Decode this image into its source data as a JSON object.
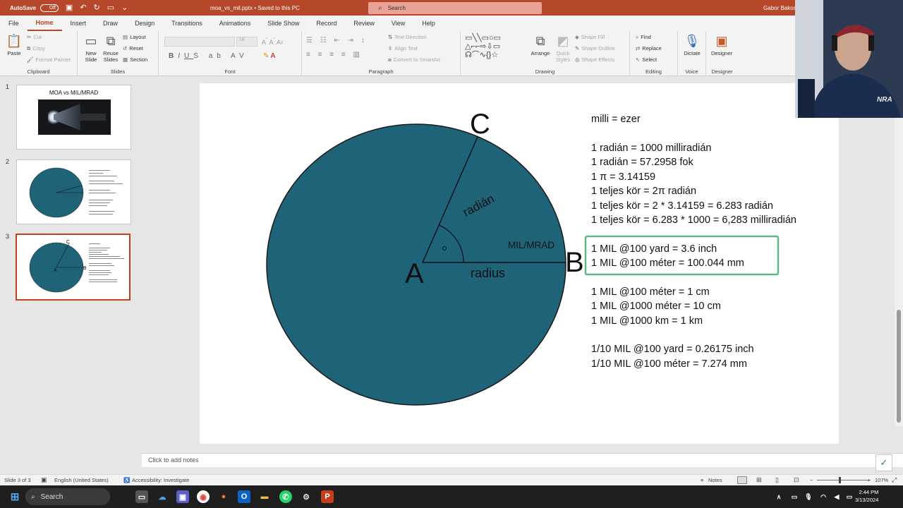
{
  "titlebar": {
    "autosave_label": "AutoSave",
    "autosave_state": "Off",
    "document_title": "moa_vs_mil.pptx • Saved to this PC",
    "search_placeholder": "Search",
    "user_name": "Gabor Bakos"
  },
  "menu_tabs": [
    "File",
    "Home",
    "Insert",
    "Draw",
    "Design",
    "Transitions",
    "Animations",
    "Slide Show",
    "Record",
    "Review",
    "View",
    "Help"
  ],
  "active_tab": "Home",
  "ribbon": {
    "clipboard": {
      "paste": "Paste",
      "cut": "Cut",
      "copy": "Copy",
      "format_painter": "Format Painter",
      "label": "Clipboard"
    },
    "slides": {
      "new_slide": "New Slide",
      "reuse_slides": "Reuse Slides",
      "layout": "Layout",
      "reset": "Reset",
      "section": "Section",
      "label": "Slides"
    },
    "font": {
      "label": "Font",
      "size": "18"
    },
    "paragraph": {
      "text_direction": "Text Direction",
      "align_text": "Align Text",
      "convert_smartart": "Convert to SmartArt",
      "label": "Paragraph"
    },
    "drawing": {
      "arrange": "Arrange",
      "quick_styles": "Quick Styles",
      "shape_fill": "Shape Fill",
      "shape_outline": "Shape Outline",
      "shape_effects": "Shape Effects",
      "label": "Drawing"
    },
    "editing": {
      "find": "Find",
      "replace": "Replace",
      "select": "Select",
      "label": "Editing"
    },
    "voice": {
      "dictate": "Dictate",
      "label": "Voice"
    },
    "designer": {
      "designer": "Designer",
      "label": "Designer"
    }
  },
  "thumbnails": [
    {
      "number": "1",
      "title": "MOA vs MIL/MRAD"
    },
    {
      "number": "2",
      "title": ""
    },
    {
      "number": "3",
      "title": "",
      "point_labels": [
        "C",
        "A",
        "B"
      ]
    }
  ],
  "slide": {
    "labels": {
      "c": "C",
      "a": "A",
      "b": "B",
      "radian": "radián",
      "mil_mrad": "MIL/MRAD",
      "radius": "radius"
    },
    "circle_color": "#1f6379",
    "highlight_color": "#5cb88a",
    "lines": [
      "milli = ezer",
      "1 radián = 1000 milliradián",
      "1 radián = 57.2958 fok",
      "1 π = 3.14159",
      "1 teljes kör = 2π radián",
      "1 teljes kör = 2 * 3.14159 = 6.283 radián",
      "1 teljes kör = 6.283 * 1000 = 6,283 milliradián",
      "1 MIL @100 yard = 3.6 inch",
      "1 MIL @100 méter = 100.044 mm",
      "1 MIL @100 méter = 1 cm",
      "1 MIL @1000 méter = 10 cm",
      "1 MIL @1000 km = 1 km",
      "1/10 MIL @100 yard = 0.26175 inch",
      "1/10 MIL @100 méter = 7.274 mm"
    ]
  },
  "notes_placeholder": "Click to add notes",
  "statusbar": {
    "slide_info": "Slide 3 of 3",
    "language": "English (United States)",
    "accessibility": "Accessibility: Investigate",
    "notes": "Notes",
    "zoom": "107%"
  },
  "taskbar": {
    "search": "Search",
    "time": "2:44 PM",
    "date": "3/13/2024"
  },
  "webcam": {
    "cap_logo": "NRA"
  }
}
